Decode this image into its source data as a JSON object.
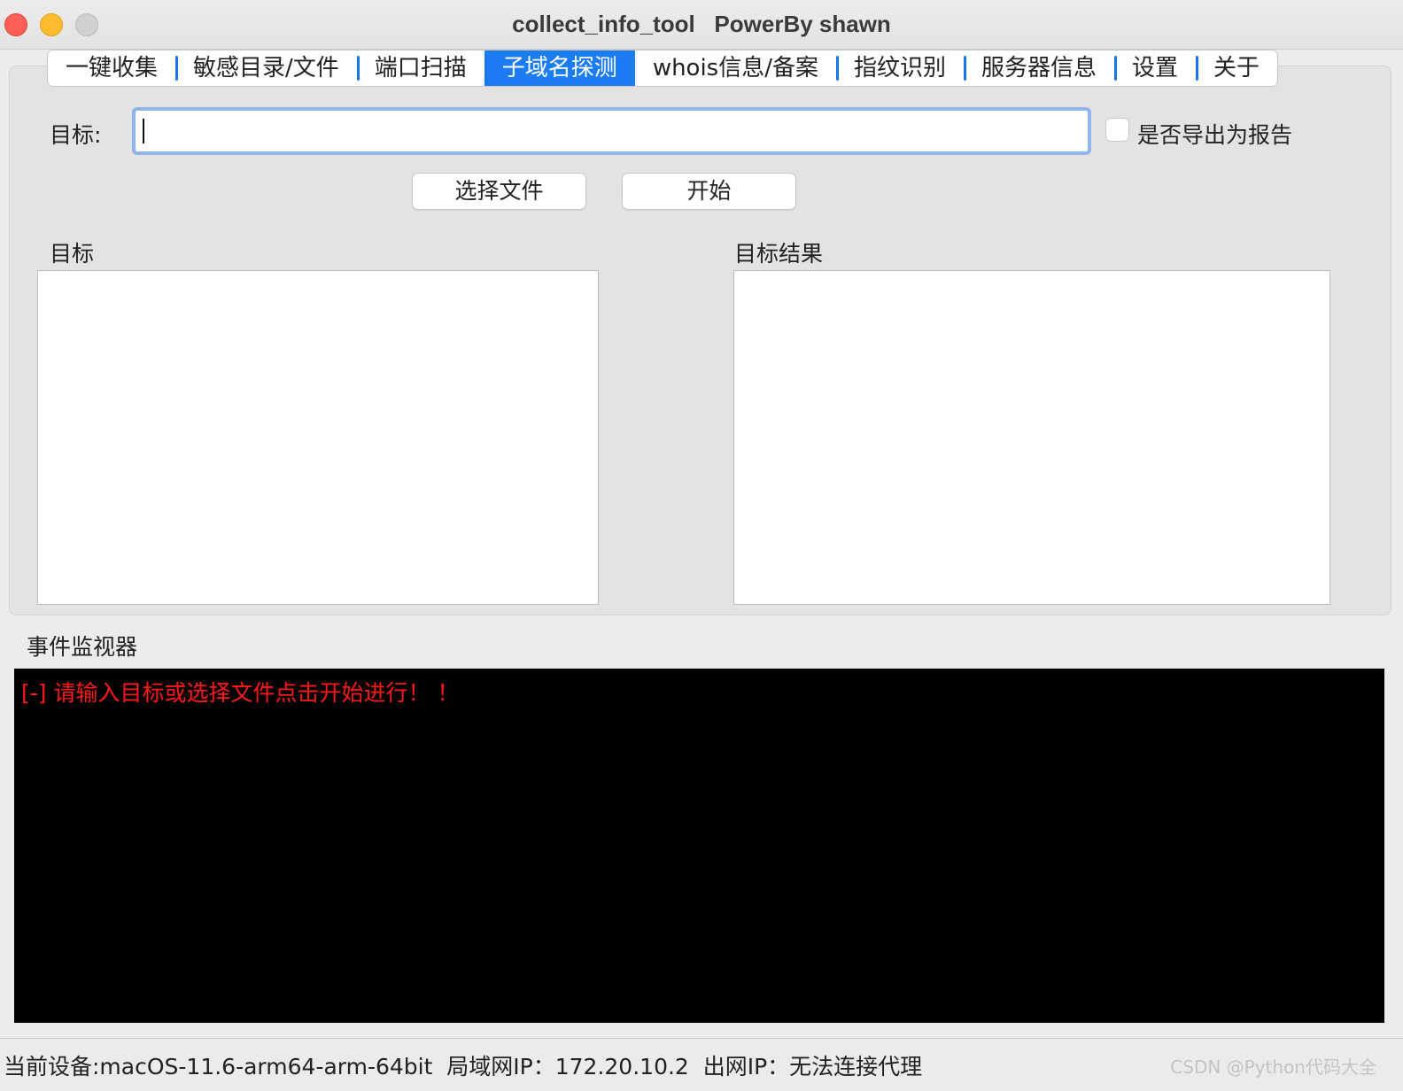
{
  "window": {
    "title": "collect_info_tool   PowerBy shawn"
  },
  "tabs": [
    {
      "label": "一键收集",
      "active": false
    },
    {
      "label": "敏感目录/文件",
      "active": false
    },
    {
      "label": "端口扫描",
      "active": false
    },
    {
      "label": "子域名探测",
      "active": true
    },
    {
      "label": "whois信息/备案",
      "active": false
    },
    {
      "label": "指纹识别",
      "active": false
    },
    {
      "label": "服务器信息",
      "active": false
    },
    {
      "label": "设置",
      "active": false
    },
    {
      "label": "关于",
      "active": false
    }
  ],
  "form": {
    "target_label": "目标:",
    "target_value": "",
    "export_label": "是否导出为报告",
    "export_checked": false,
    "choose_file_label": "选择文件",
    "start_label": "开始"
  },
  "panes": {
    "targets_title": "目标",
    "results_title": "目标结果"
  },
  "monitor": {
    "title": "事件监视器",
    "lines": [
      "[-] 请输入目标或选择文件点击开始进行！ ！"
    ],
    "text_color": "#ff1a1a"
  },
  "status": {
    "text": "当前设备:macOS-11.6-arm64-arm-64bit  局域网IP：172.20.10.2  出网IP：无法连接代理"
  },
  "watermark": "CSDN @Python代码大全",
  "colors": {
    "accent": "#1c7cf4",
    "focus_ring": "#8fb4ea",
    "console_bg": "#000000"
  }
}
